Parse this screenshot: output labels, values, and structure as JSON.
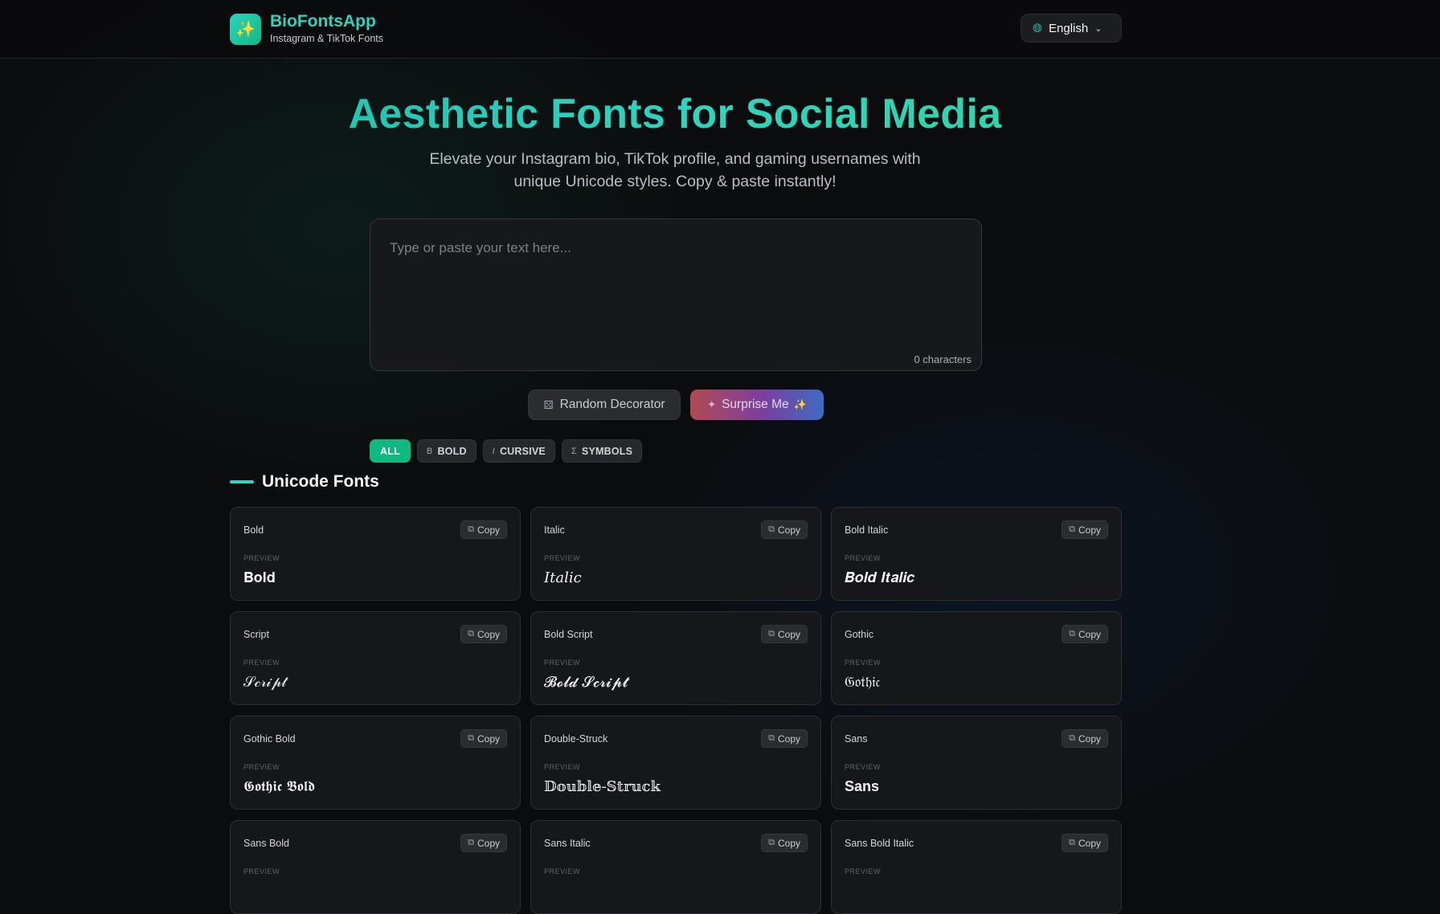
{
  "header": {
    "logo_icon": "sparkles-icon",
    "app_name": "BioFontsApp",
    "tagline": "Instagram & TikTok Fonts",
    "language_icon": "globe-icon",
    "language": "English"
  },
  "hero": {
    "title": "Aesthetic Fonts for Social Media",
    "subtitle": "Elevate your Instagram bio, TikTok profile, and gaming usernames with unique Unicode styles. Copy & paste instantly!"
  },
  "input": {
    "placeholder": "Type or paste your text here...",
    "value": "",
    "char_count": "0 characters"
  },
  "actions": {
    "random_label": "Random Decorator",
    "surprise_label": "Surprise Me",
    "surprise_emoji": "✨"
  },
  "filters": [
    {
      "label": "ALL",
      "icon": "",
      "active": true
    },
    {
      "label": "BOLD",
      "icon": "B",
      "active": false
    },
    {
      "label": "CURSIVE",
      "icon": "I",
      "active": false
    },
    {
      "label": "SYMBOLS",
      "icon": "Σ",
      "active": false
    }
  ],
  "section": {
    "title": "Unicode Fonts"
  },
  "fonts": {
    "preview_label": "PREVIEW",
    "copy_label": "Copy",
    "items": [
      {
        "name": "Bold",
        "preview": "𝐁𝐨𝐥𝐝"
      },
      {
        "name": "Italic",
        "preview": "𝐼𝑡𝑎𝑙𝑖𝑐"
      },
      {
        "name": "Bold Italic",
        "preview": "𝑩𝒐𝒍𝒅 𝑰𝒕𝒂𝒍𝒊𝒄"
      },
      {
        "name": "Script",
        "preview": "𝒮𝒸𝓇𝒾𝓅𝓉"
      },
      {
        "name": "Bold Script",
        "preview": "𝓑𝓸𝓵𝓭 𝓢𝓬𝓻𝓲𝓹𝓽"
      },
      {
        "name": "Gothic",
        "preview": "𝔊𝔬𝔱𝔥𝔦𝔠"
      },
      {
        "name": "Gothic Bold",
        "preview": "𝕲𝖔𝖙𝖍𝖎𝖈 𝕭𝖔𝖑𝖉"
      },
      {
        "name": "Double-Struck",
        "preview": "𝔻𝕠𝕦𝕓𝕝𝕖-𝕊𝕥𝕣𝕦𝕔𝕜"
      },
      {
        "name": "Sans",
        "preview": "Sans"
      },
      {
        "name": "Sans Bold",
        "preview": ""
      },
      {
        "name": "Sans Italic",
        "preview": ""
      },
      {
        "name": "Sans Bold Italic",
        "preview": ""
      }
    ]
  },
  "colors": {
    "accent": "#2dd4bf",
    "active_chip": "#10b981",
    "background": "#0b0c0e",
    "card": "#16171a"
  }
}
